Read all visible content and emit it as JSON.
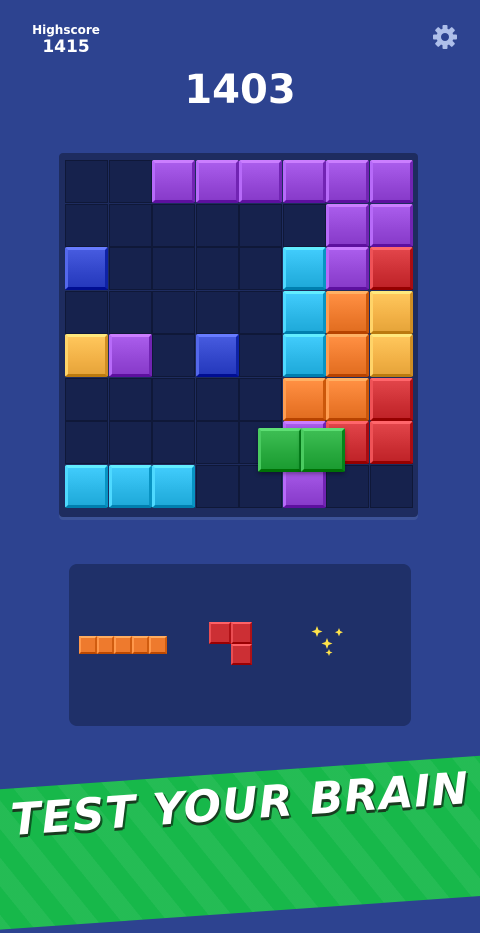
{
  "header": {
    "highscore_label": "Highscore",
    "highscore_value": "1415",
    "settings_icon": "gear-icon",
    "score": "1403"
  },
  "board": {
    "rows": 8,
    "cols": 8,
    "colors": {
      "purple": "#9447d6",
      "red": "#cc2f34",
      "orange": "#ee7a2d",
      "yellow": "#f2b146",
      "cyan": "#2bb6e6",
      "blue": "#3145c9",
      "green": "#27a83d"
    },
    "placed_blocks": [
      [
        0,
        2,
        "purple"
      ],
      [
        0,
        3,
        "purple"
      ],
      [
        0,
        4,
        "purple"
      ],
      [
        0,
        5,
        "purple"
      ],
      [
        0,
        6,
        "purple"
      ],
      [
        0,
        7,
        "purple"
      ],
      [
        1,
        6,
        "purple"
      ],
      [
        1,
        7,
        "purple"
      ],
      [
        2,
        0,
        "blue"
      ],
      [
        2,
        5,
        "cyan"
      ],
      [
        2,
        6,
        "purple"
      ],
      [
        2,
        7,
        "red"
      ],
      [
        3,
        5,
        "cyan"
      ],
      [
        3,
        6,
        "orange"
      ],
      [
        3,
        7,
        "yellow"
      ],
      [
        4,
        0,
        "yellow"
      ],
      [
        4,
        1,
        "purple"
      ],
      [
        4,
        3,
        "blue"
      ],
      [
        4,
        5,
        "cyan"
      ],
      [
        4,
        6,
        "orange"
      ],
      [
        4,
        7,
        "yellow"
      ],
      [
        5,
        5,
        "orange"
      ],
      [
        5,
        6,
        "orange"
      ],
      [
        5,
        7,
        "red"
      ],
      [
        6,
        5,
        "purple"
      ],
      [
        6,
        6,
        "red"
      ],
      [
        6,
        7,
        "red"
      ],
      [
        7,
        0,
        "cyan"
      ],
      [
        7,
        1,
        "cyan"
      ],
      [
        7,
        2,
        "cyan"
      ],
      [
        7,
        5,
        "purple"
      ]
    ],
    "dragging_piece": {
      "color": "green",
      "cells": [
        [
          6,
          5
        ],
        [
          6,
          6
        ]
      ]
    }
  },
  "tray": {
    "pieces": [
      {
        "name": "orange-line-piece",
        "color": "orange",
        "shape": [
          [
            0,
            0
          ],
          [
            0,
            1
          ],
          [
            0,
            2
          ],
          [
            0,
            3
          ],
          [
            0,
            4
          ]
        ]
      },
      {
        "name": "red-s-piece",
        "color": "red",
        "shape": [
          [
            0,
            0
          ],
          [
            0,
            1
          ],
          [
            1,
            1
          ]
        ]
      },
      {
        "name": "sparkle-empty-slot",
        "icon": "sparkle-icon"
      }
    ]
  },
  "banner": {
    "text": "TEST YOUR BRAIN"
  }
}
